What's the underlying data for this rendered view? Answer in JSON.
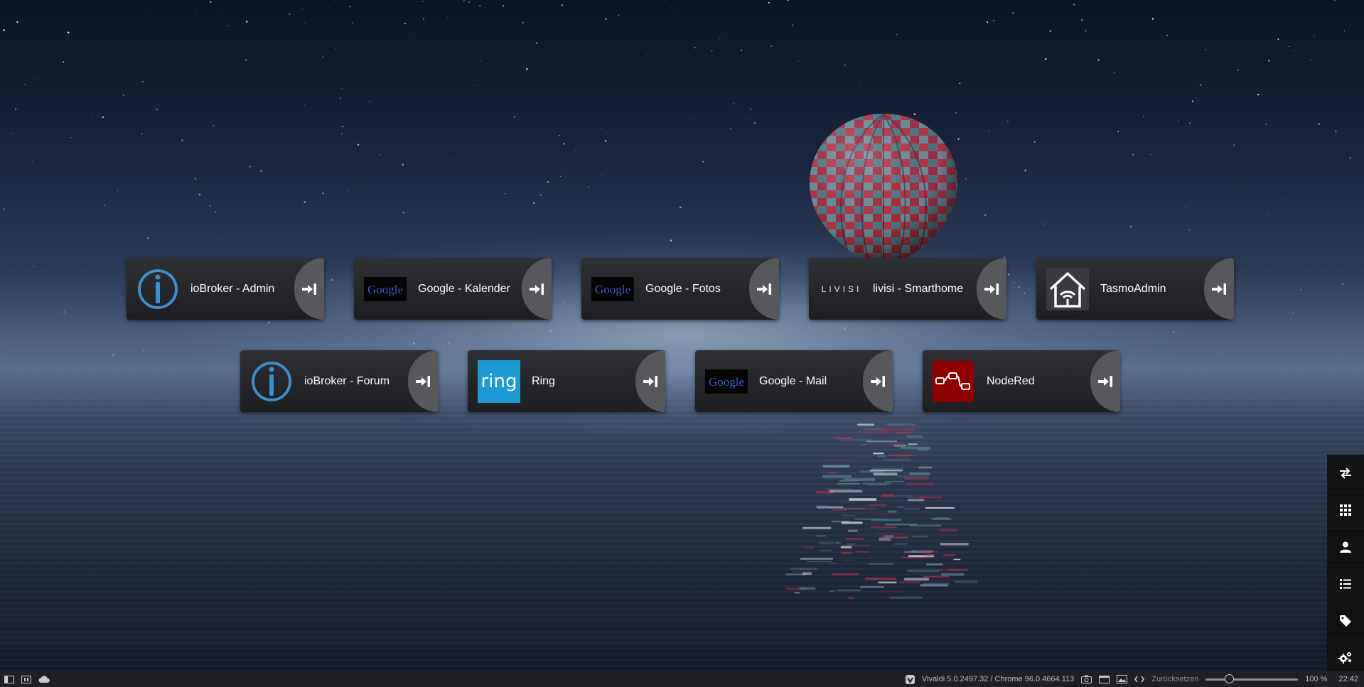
{
  "tiles": [
    {
      "label": "ioBroker - Admin",
      "logo": "iobroker-logo"
    },
    {
      "label": "Google - Kalender",
      "logo": "google-logo",
      "logo_text": "Google"
    },
    {
      "label": "Google - Fotos",
      "logo": "google-logo",
      "logo_text": "Google"
    },
    {
      "label": "livisi - Smarthome",
      "logo": "livisi-logo",
      "logo_text": "LIVISI"
    },
    {
      "label": "TasmoAdmin",
      "logo": "house-wifi-logo"
    },
    {
      "label": "ioBroker - Forum",
      "logo": "iobroker-logo"
    },
    {
      "label": "Ring",
      "logo": "ring-logo",
      "logo_text": "ring"
    },
    {
      "label": "Google - Mail",
      "logo": "google-logo",
      "logo_text": "Google"
    },
    {
      "label": "NodeRed",
      "logo": "nodered-logo"
    }
  ],
  "tile_action_icon": "sign-in-icon",
  "sidebar": {
    "items": [
      "swap-icon",
      "grid-icon",
      "user-icon",
      "list-icon",
      "tag-icon",
      "settings-icon"
    ]
  },
  "statusbar": {
    "left_icons": [
      "panel-toggle-icon",
      "tab-tiling-icon",
      "sync-cloud-icon"
    ],
    "browser_version": "Vivaldi 5.0.2497.32 / Chrome 96.0.4664.113",
    "reset_label": "Zurücksetzen",
    "zoom": "100 %",
    "zoom_level": 0.25,
    "clock": "22:42"
  },
  "colors": {
    "tile_bg": "#2a2b2e",
    "tile_action_bg": "#56585c",
    "iobroker_blue": "#3a8fd0",
    "ring_blue": "#1c9ad6",
    "nodered_red": "#8f0000"
  }
}
